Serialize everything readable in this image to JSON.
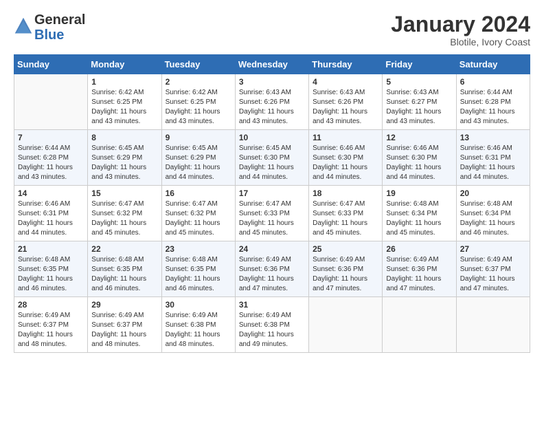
{
  "header": {
    "logo_general": "General",
    "logo_blue": "Blue",
    "title": "January 2024",
    "subtitle": "Blotile, Ivory Coast"
  },
  "days_of_week": [
    "Sunday",
    "Monday",
    "Tuesday",
    "Wednesday",
    "Thursday",
    "Friday",
    "Saturday"
  ],
  "weeks": [
    [
      {
        "day": "",
        "empty": true
      },
      {
        "day": "1",
        "sunrise": "Sunrise: 6:42 AM",
        "sunset": "Sunset: 6:25 PM",
        "daylight": "Daylight: 11 hours and 43 minutes."
      },
      {
        "day": "2",
        "sunrise": "Sunrise: 6:42 AM",
        "sunset": "Sunset: 6:25 PM",
        "daylight": "Daylight: 11 hours and 43 minutes."
      },
      {
        "day": "3",
        "sunrise": "Sunrise: 6:43 AM",
        "sunset": "Sunset: 6:26 PM",
        "daylight": "Daylight: 11 hours and 43 minutes."
      },
      {
        "day": "4",
        "sunrise": "Sunrise: 6:43 AM",
        "sunset": "Sunset: 6:26 PM",
        "daylight": "Daylight: 11 hours and 43 minutes."
      },
      {
        "day": "5",
        "sunrise": "Sunrise: 6:43 AM",
        "sunset": "Sunset: 6:27 PM",
        "daylight": "Daylight: 11 hours and 43 minutes."
      },
      {
        "day": "6",
        "sunrise": "Sunrise: 6:44 AM",
        "sunset": "Sunset: 6:28 PM",
        "daylight": "Daylight: 11 hours and 43 minutes."
      }
    ],
    [
      {
        "day": "7",
        "sunrise": "Sunrise: 6:44 AM",
        "sunset": "Sunset: 6:28 PM",
        "daylight": "Daylight: 11 hours and 43 minutes."
      },
      {
        "day": "8",
        "sunrise": "Sunrise: 6:45 AM",
        "sunset": "Sunset: 6:29 PM",
        "daylight": "Daylight: 11 hours and 43 minutes."
      },
      {
        "day": "9",
        "sunrise": "Sunrise: 6:45 AM",
        "sunset": "Sunset: 6:29 PM",
        "daylight": "Daylight: 11 hours and 44 minutes."
      },
      {
        "day": "10",
        "sunrise": "Sunrise: 6:45 AM",
        "sunset": "Sunset: 6:30 PM",
        "daylight": "Daylight: 11 hours and 44 minutes."
      },
      {
        "day": "11",
        "sunrise": "Sunrise: 6:46 AM",
        "sunset": "Sunset: 6:30 PM",
        "daylight": "Daylight: 11 hours and 44 minutes."
      },
      {
        "day": "12",
        "sunrise": "Sunrise: 6:46 AM",
        "sunset": "Sunset: 6:30 PM",
        "daylight": "Daylight: 11 hours and 44 minutes."
      },
      {
        "day": "13",
        "sunrise": "Sunrise: 6:46 AM",
        "sunset": "Sunset: 6:31 PM",
        "daylight": "Daylight: 11 hours and 44 minutes."
      }
    ],
    [
      {
        "day": "14",
        "sunrise": "Sunrise: 6:46 AM",
        "sunset": "Sunset: 6:31 PM",
        "daylight": "Daylight: 11 hours and 44 minutes."
      },
      {
        "day": "15",
        "sunrise": "Sunrise: 6:47 AM",
        "sunset": "Sunset: 6:32 PM",
        "daylight": "Daylight: 11 hours and 45 minutes."
      },
      {
        "day": "16",
        "sunrise": "Sunrise: 6:47 AM",
        "sunset": "Sunset: 6:32 PM",
        "daylight": "Daylight: 11 hours and 45 minutes."
      },
      {
        "day": "17",
        "sunrise": "Sunrise: 6:47 AM",
        "sunset": "Sunset: 6:33 PM",
        "daylight": "Daylight: 11 hours and 45 minutes."
      },
      {
        "day": "18",
        "sunrise": "Sunrise: 6:47 AM",
        "sunset": "Sunset: 6:33 PM",
        "daylight": "Daylight: 11 hours and 45 minutes."
      },
      {
        "day": "19",
        "sunrise": "Sunrise: 6:48 AM",
        "sunset": "Sunset: 6:34 PM",
        "daylight": "Daylight: 11 hours and 45 minutes."
      },
      {
        "day": "20",
        "sunrise": "Sunrise: 6:48 AM",
        "sunset": "Sunset: 6:34 PM",
        "daylight": "Daylight: 11 hours and 46 minutes."
      }
    ],
    [
      {
        "day": "21",
        "sunrise": "Sunrise: 6:48 AM",
        "sunset": "Sunset: 6:35 PM",
        "daylight": "Daylight: 11 hours and 46 minutes."
      },
      {
        "day": "22",
        "sunrise": "Sunrise: 6:48 AM",
        "sunset": "Sunset: 6:35 PM",
        "daylight": "Daylight: 11 hours and 46 minutes."
      },
      {
        "day": "23",
        "sunrise": "Sunrise: 6:48 AM",
        "sunset": "Sunset: 6:35 PM",
        "daylight": "Daylight: 11 hours and 46 minutes."
      },
      {
        "day": "24",
        "sunrise": "Sunrise: 6:49 AM",
        "sunset": "Sunset: 6:36 PM",
        "daylight": "Daylight: 11 hours and 47 minutes."
      },
      {
        "day": "25",
        "sunrise": "Sunrise: 6:49 AM",
        "sunset": "Sunset: 6:36 PM",
        "daylight": "Daylight: 11 hours and 47 minutes."
      },
      {
        "day": "26",
        "sunrise": "Sunrise: 6:49 AM",
        "sunset": "Sunset: 6:36 PM",
        "daylight": "Daylight: 11 hours and 47 minutes."
      },
      {
        "day": "27",
        "sunrise": "Sunrise: 6:49 AM",
        "sunset": "Sunset: 6:37 PM",
        "daylight": "Daylight: 11 hours and 47 minutes."
      }
    ],
    [
      {
        "day": "28",
        "sunrise": "Sunrise: 6:49 AM",
        "sunset": "Sunset: 6:37 PM",
        "daylight": "Daylight: 11 hours and 48 minutes."
      },
      {
        "day": "29",
        "sunrise": "Sunrise: 6:49 AM",
        "sunset": "Sunset: 6:37 PM",
        "daylight": "Daylight: 11 hours and 48 minutes."
      },
      {
        "day": "30",
        "sunrise": "Sunrise: 6:49 AM",
        "sunset": "Sunset: 6:38 PM",
        "daylight": "Daylight: 11 hours and 48 minutes."
      },
      {
        "day": "31",
        "sunrise": "Sunrise: 6:49 AM",
        "sunset": "Sunset: 6:38 PM",
        "daylight": "Daylight: 11 hours and 49 minutes."
      },
      {
        "day": "",
        "empty": true
      },
      {
        "day": "",
        "empty": true
      },
      {
        "day": "",
        "empty": true
      }
    ]
  ]
}
